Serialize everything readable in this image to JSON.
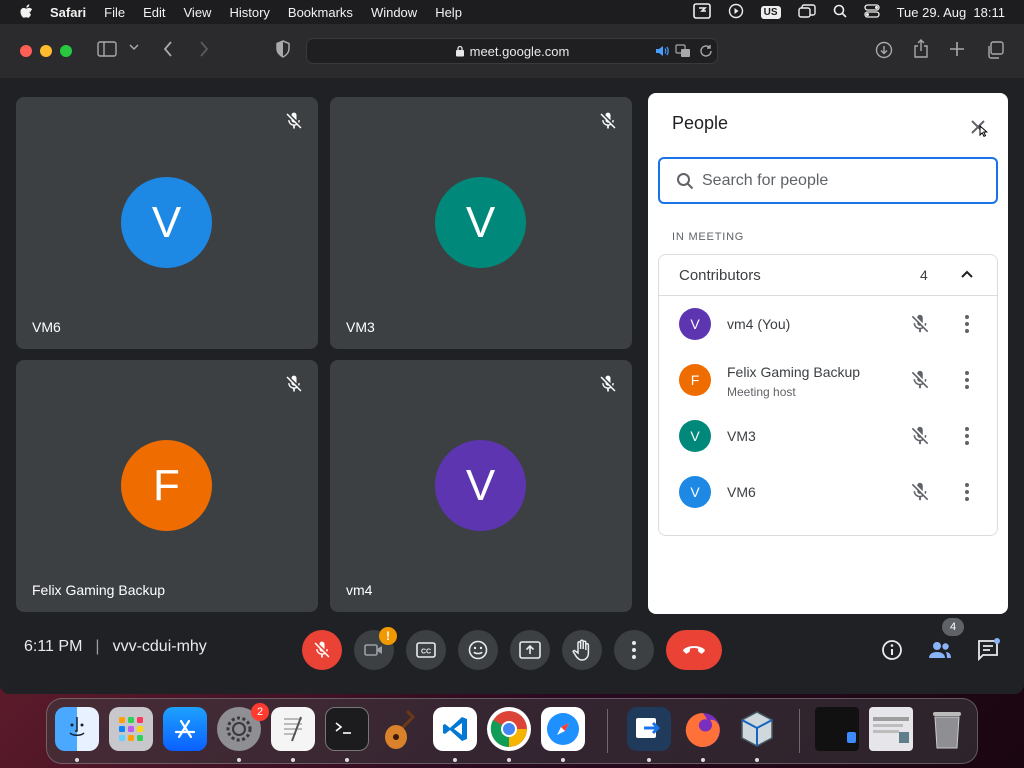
{
  "menubar": {
    "items": [
      "Safari",
      "File",
      "Edit",
      "View",
      "History",
      "Bookmarks",
      "Window",
      "Help"
    ],
    "input_source": "US",
    "datetime": "Tue 29. Aug  18:11"
  },
  "browser": {
    "url": "meet.google.com"
  },
  "tiles": [
    {
      "initial": "V",
      "name": "VM6",
      "color": "#1e88e5"
    },
    {
      "initial": "V",
      "name": "VM3",
      "color": "#00897b"
    },
    {
      "initial": "F",
      "name": "Felix Gaming Backup",
      "color": "#ef6c00"
    },
    {
      "initial": "V",
      "name": "vm4",
      "color": "#5e35b1"
    }
  ],
  "people": {
    "title": "People",
    "search_placeholder": "Search for people",
    "section_label": "IN MEETING",
    "group_label": "Contributors",
    "group_count": "4",
    "list": [
      {
        "initial": "V",
        "name": "vm4 (You)",
        "sub": "",
        "color": "#5e35b1"
      },
      {
        "initial": "F",
        "name": "Felix Gaming Backup",
        "sub": "Meeting host",
        "color": "#ef6c00"
      },
      {
        "initial": "V",
        "name": "VM3",
        "sub": "",
        "color": "#00897b"
      },
      {
        "initial": "V",
        "name": "VM6",
        "sub": "",
        "color": "#1e88e5"
      }
    ]
  },
  "bottombar": {
    "time": "6:11 PM",
    "separator": "|",
    "meeting_code": "vvv-cdui-mhy",
    "participant_badge": "4"
  },
  "dock": {
    "settings_badge": "2"
  }
}
